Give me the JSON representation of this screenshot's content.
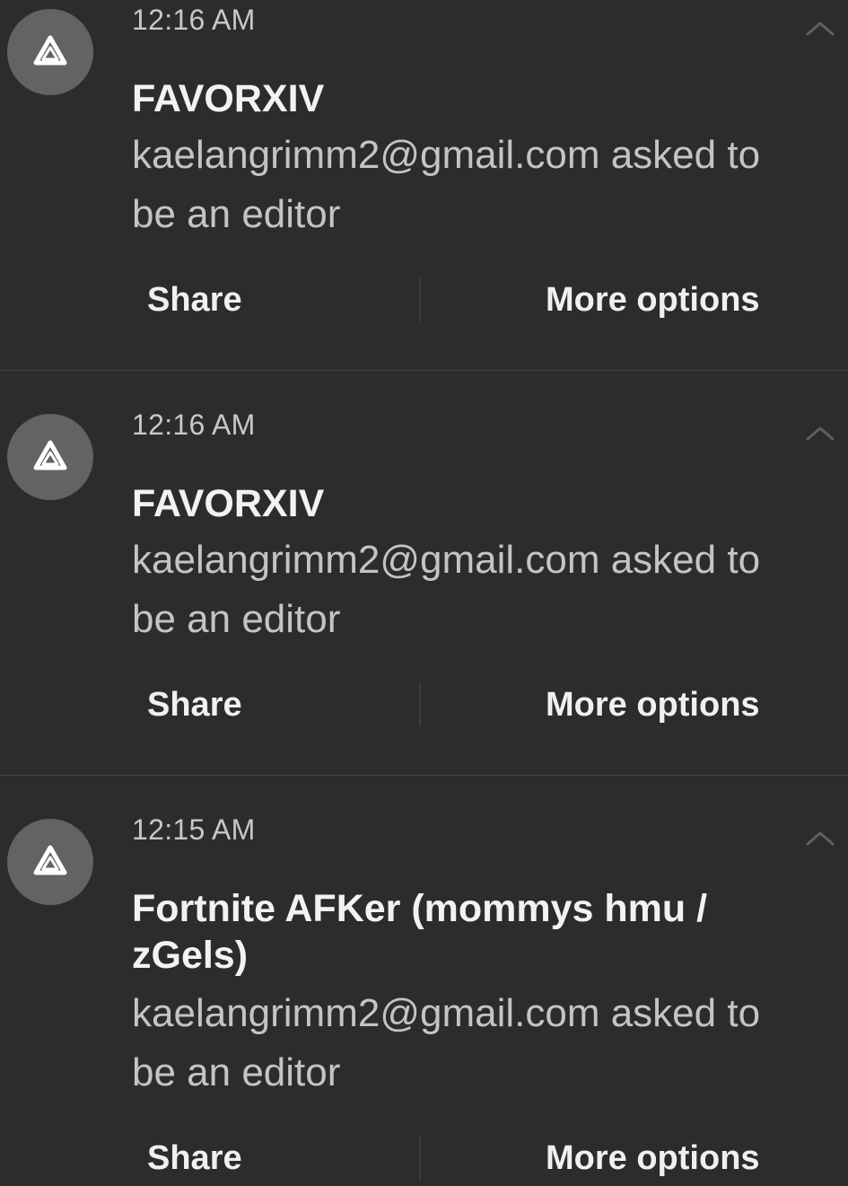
{
  "notifications": [
    {
      "time": "12:16 AM",
      "title": "FAVORXIV",
      "body": "kaelangrimm2@gmail.com asked to be an editor",
      "actions": {
        "share": "Share",
        "more": "More options"
      }
    },
    {
      "time": "12:16 AM",
      "title": "FAVORXIV",
      "body": "kaelangrimm2@gmail.com asked to be an editor",
      "actions": {
        "share": "Share",
        "more": "More options"
      }
    },
    {
      "time": "12:15 AM",
      "title": "Fortnite AFKer (mommys hmu / zGels)",
      "body": "kaelangrimm2@gmail.com asked to be an editor",
      "actions": {
        "share": "Share",
        "more": "More options"
      }
    }
  ],
  "icons": {
    "app": "drive-icon",
    "expand": "chevron-up-icon"
  },
  "colors": {
    "background": "#2c2c2c",
    "icon_circle": "#636363",
    "title_text": "#f2f2f2",
    "body_text": "#c4c4c4"
  }
}
